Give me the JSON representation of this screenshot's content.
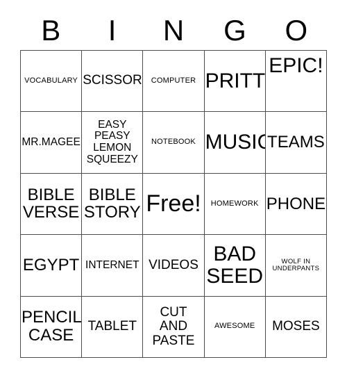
{
  "card": {
    "header": {
      "letters": [
        "B",
        "I",
        "N",
        "G",
        "O"
      ]
    },
    "rows": [
      [
        {
          "text": "VOCABULARY",
          "size": "sz-s",
          "valign": "valign-center"
        },
        {
          "text": "SCISSORS",
          "size": "sz-l",
          "valign": "valign-center"
        },
        {
          "text": "COMPUTER",
          "size": "sz-s",
          "valign": "valign-center"
        },
        {
          "text": "PRITT",
          "size": "sz-xxl",
          "valign": "valign-center"
        },
        {
          "text": "EPIC!",
          "size": "sz-xxl",
          "valign": "valign-top"
        }
      ],
      [
        {
          "text": "MR.MAGEE",
          "size": "sz-m",
          "valign": "valign-center"
        },
        {
          "text": "EASY\nPEASY\nLEMON\nSQUEEZY",
          "size": "sz-m",
          "valign": "valign-center"
        },
        {
          "text": "NOTEBOOK",
          "size": "sz-s",
          "valign": "valign-center"
        },
        {
          "text": "MUSIC",
          "size": "sz-xxl",
          "valign": "valign-center"
        },
        {
          "text": "TEAMS",
          "size": "sz-xl",
          "valign": "valign-center"
        }
      ],
      [
        {
          "text": "BIBLE\nVERSE",
          "size": "sz-xl",
          "valign": "valign-center"
        },
        {
          "text": "BIBLE\nSTORY",
          "size": "sz-xl",
          "valign": "valign-center"
        },
        {
          "text": "Free!",
          "size": "sz-free",
          "valign": "valign-center"
        },
        {
          "text": "HOMEWORK",
          "size": "sz-s",
          "valign": "valign-center"
        },
        {
          "text": "PHONE",
          "size": "sz-xl",
          "valign": "valign-center"
        }
      ],
      [
        {
          "text": "EGYPT",
          "size": "sz-xl",
          "valign": "valign-center"
        },
        {
          "text": "INTERNET",
          "size": "sz-m",
          "valign": "valign-center"
        },
        {
          "text": "VIDEOS",
          "size": "sz-l",
          "valign": "valign-center"
        },
        {
          "text": "BAD\nSEED",
          "size": "sz-xxl",
          "valign": "valign-center"
        },
        {
          "text": "WOLF IN\nUNDERPANTS",
          "size": "sz-xs",
          "valign": "valign-center"
        }
      ],
      [
        {
          "text": "PENCIL\nCASE",
          "size": "sz-xl",
          "valign": "valign-center"
        },
        {
          "text": "TABLET",
          "size": "sz-l",
          "valign": "valign-center"
        },
        {
          "text": "CUT\nAND\nPASTE",
          "size": "sz-l",
          "valign": "valign-center"
        },
        {
          "text": "AWESOME",
          "size": "sz-s",
          "valign": "valign-center"
        },
        {
          "text": "MOSES",
          "size": "sz-l",
          "valign": "valign-center"
        }
      ]
    ],
    "colors": {
      "background": "#ffffff",
      "text": "#000000",
      "border": "#4d4d4d"
    }
  }
}
